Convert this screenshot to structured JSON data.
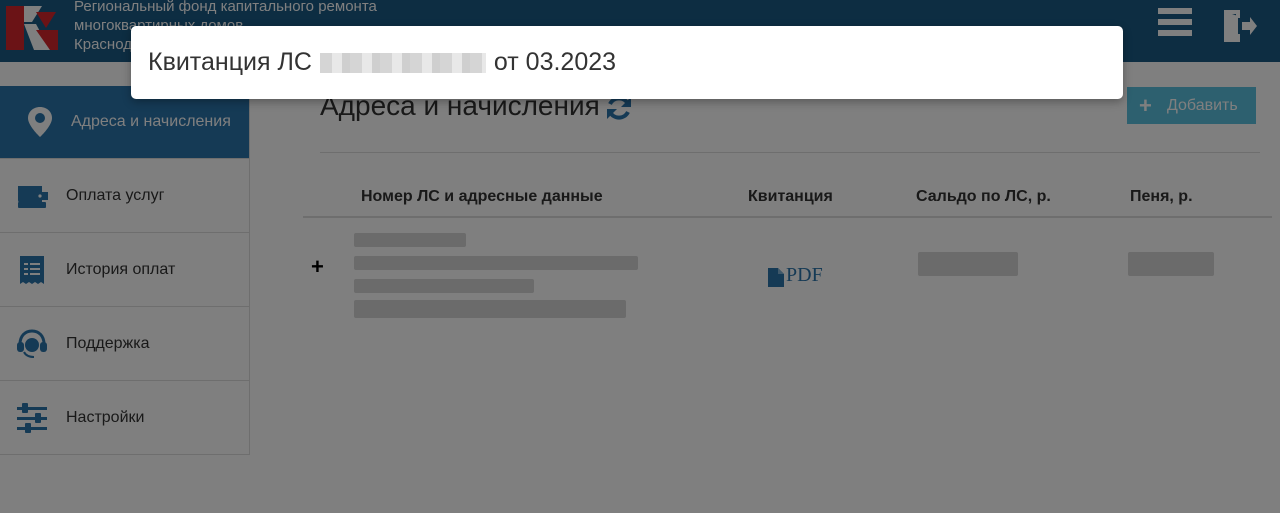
{
  "header": {
    "org_name": "Региональный фонд капитального ремонта\nмногоквартирных домов\nКраснодарского края",
    "brand_color": "#1b5a85"
  },
  "sidebar": {
    "items": [
      {
        "label": "Адреса и начисления",
        "icon": "map-marker-icon",
        "active": true
      },
      {
        "label": "Оплата услуг",
        "icon": "wallet-icon",
        "active": false
      },
      {
        "label": "История оплат",
        "icon": "receipt-icon",
        "active": false
      },
      {
        "label": "Поддержка",
        "icon": "headset-icon",
        "active": false
      },
      {
        "label": "Настройки",
        "icon": "sliders-icon",
        "active": false
      }
    ]
  },
  "main": {
    "title": "Адреса и начисления",
    "add_label": "Добавить",
    "table": {
      "columns": [
        "Номер ЛС и адресные данные",
        "Квитанция",
        "Сальдо по ЛС, р.",
        "Пеня, р."
      ],
      "rows": [
        {
          "expand": "+",
          "receipt": "PDF"
        }
      ]
    }
  },
  "dialog": {
    "title_prefix": "Квитанция ЛС",
    "title_suffix": "от 03.2023"
  },
  "colors": {
    "accent": "#2b74aa",
    "button": "#5bc0de",
    "logo_red": "#d7262d"
  }
}
